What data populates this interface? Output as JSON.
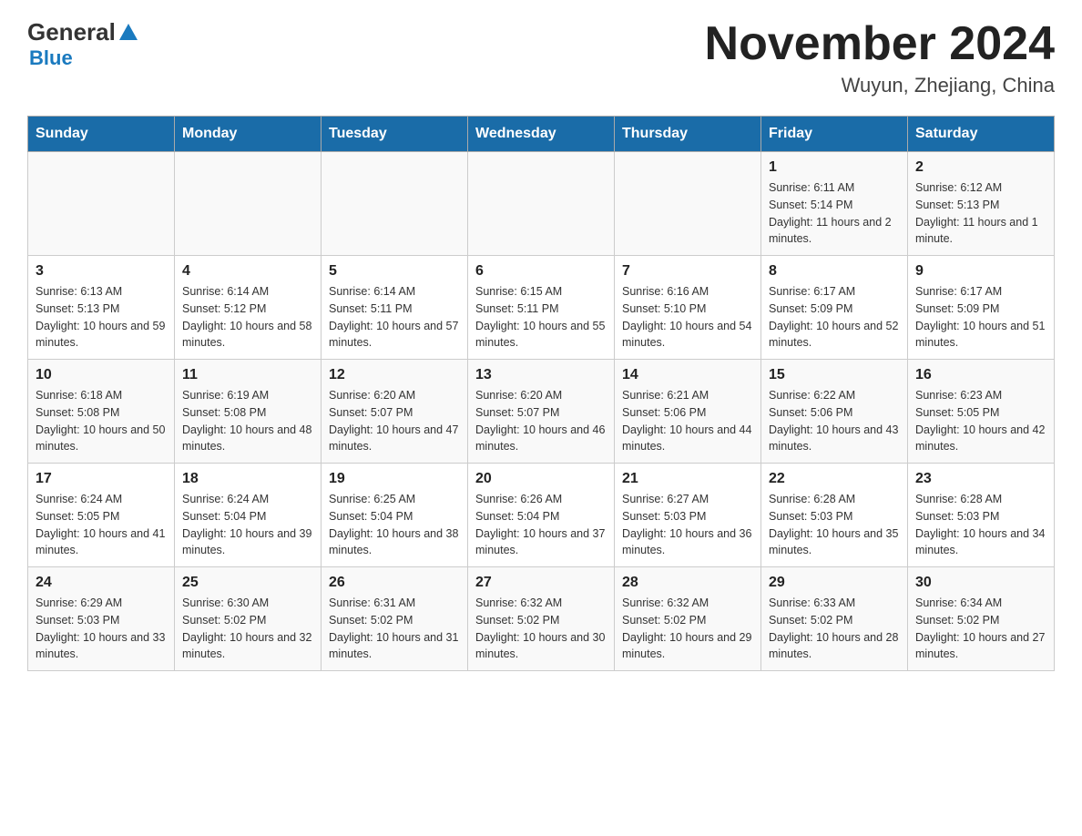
{
  "header": {
    "logo": {
      "general": "General",
      "blue": "Blue",
      "subtitle": "Blue"
    },
    "title": "November 2024",
    "location": "Wuyun, Zhejiang, China"
  },
  "days_of_week": [
    "Sunday",
    "Monday",
    "Tuesday",
    "Wednesday",
    "Thursday",
    "Friday",
    "Saturday"
  ],
  "weeks": [
    {
      "days": [
        {
          "number": "",
          "sunrise": "",
          "sunset": "",
          "daylight": ""
        },
        {
          "number": "",
          "sunrise": "",
          "sunset": "",
          "daylight": ""
        },
        {
          "number": "",
          "sunrise": "",
          "sunset": "",
          "daylight": ""
        },
        {
          "number": "",
          "sunrise": "",
          "sunset": "",
          "daylight": ""
        },
        {
          "number": "",
          "sunrise": "",
          "sunset": "",
          "daylight": ""
        },
        {
          "number": "1",
          "sunrise": "Sunrise: 6:11 AM",
          "sunset": "Sunset: 5:14 PM",
          "daylight": "Daylight: 11 hours and 2 minutes."
        },
        {
          "number": "2",
          "sunrise": "Sunrise: 6:12 AM",
          "sunset": "Sunset: 5:13 PM",
          "daylight": "Daylight: 11 hours and 1 minute."
        }
      ]
    },
    {
      "days": [
        {
          "number": "3",
          "sunrise": "Sunrise: 6:13 AM",
          "sunset": "Sunset: 5:13 PM",
          "daylight": "Daylight: 10 hours and 59 minutes."
        },
        {
          "number": "4",
          "sunrise": "Sunrise: 6:14 AM",
          "sunset": "Sunset: 5:12 PM",
          "daylight": "Daylight: 10 hours and 58 minutes."
        },
        {
          "number": "5",
          "sunrise": "Sunrise: 6:14 AM",
          "sunset": "Sunset: 5:11 PM",
          "daylight": "Daylight: 10 hours and 57 minutes."
        },
        {
          "number": "6",
          "sunrise": "Sunrise: 6:15 AM",
          "sunset": "Sunset: 5:11 PM",
          "daylight": "Daylight: 10 hours and 55 minutes."
        },
        {
          "number": "7",
          "sunrise": "Sunrise: 6:16 AM",
          "sunset": "Sunset: 5:10 PM",
          "daylight": "Daylight: 10 hours and 54 minutes."
        },
        {
          "number": "8",
          "sunrise": "Sunrise: 6:17 AM",
          "sunset": "Sunset: 5:09 PM",
          "daylight": "Daylight: 10 hours and 52 minutes."
        },
        {
          "number": "9",
          "sunrise": "Sunrise: 6:17 AM",
          "sunset": "Sunset: 5:09 PM",
          "daylight": "Daylight: 10 hours and 51 minutes."
        }
      ]
    },
    {
      "days": [
        {
          "number": "10",
          "sunrise": "Sunrise: 6:18 AM",
          "sunset": "Sunset: 5:08 PM",
          "daylight": "Daylight: 10 hours and 50 minutes."
        },
        {
          "number": "11",
          "sunrise": "Sunrise: 6:19 AM",
          "sunset": "Sunset: 5:08 PM",
          "daylight": "Daylight: 10 hours and 48 minutes."
        },
        {
          "number": "12",
          "sunrise": "Sunrise: 6:20 AM",
          "sunset": "Sunset: 5:07 PM",
          "daylight": "Daylight: 10 hours and 47 minutes."
        },
        {
          "number": "13",
          "sunrise": "Sunrise: 6:20 AM",
          "sunset": "Sunset: 5:07 PM",
          "daylight": "Daylight: 10 hours and 46 minutes."
        },
        {
          "number": "14",
          "sunrise": "Sunrise: 6:21 AM",
          "sunset": "Sunset: 5:06 PM",
          "daylight": "Daylight: 10 hours and 44 minutes."
        },
        {
          "number": "15",
          "sunrise": "Sunrise: 6:22 AM",
          "sunset": "Sunset: 5:06 PM",
          "daylight": "Daylight: 10 hours and 43 minutes."
        },
        {
          "number": "16",
          "sunrise": "Sunrise: 6:23 AM",
          "sunset": "Sunset: 5:05 PM",
          "daylight": "Daylight: 10 hours and 42 minutes."
        }
      ]
    },
    {
      "days": [
        {
          "number": "17",
          "sunrise": "Sunrise: 6:24 AM",
          "sunset": "Sunset: 5:05 PM",
          "daylight": "Daylight: 10 hours and 41 minutes."
        },
        {
          "number": "18",
          "sunrise": "Sunrise: 6:24 AM",
          "sunset": "Sunset: 5:04 PM",
          "daylight": "Daylight: 10 hours and 39 minutes."
        },
        {
          "number": "19",
          "sunrise": "Sunrise: 6:25 AM",
          "sunset": "Sunset: 5:04 PM",
          "daylight": "Daylight: 10 hours and 38 minutes."
        },
        {
          "number": "20",
          "sunrise": "Sunrise: 6:26 AM",
          "sunset": "Sunset: 5:04 PM",
          "daylight": "Daylight: 10 hours and 37 minutes."
        },
        {
          "number": "21",
          "sunrise": "Sunrise: 6:27 AM",
          "sunset": "Sunset: 5:03 PM",
          "daylight": "Daylight: 10 hours and 36 minutes."
        },
        {
          "number": "22",
          "sunrise": "Sunrise: 6:28 AM",
          "sunset": "Sunset: 5:03 PM",
          "daylight": "Daylight: 10 hours and 35 minutes."
        },
        {
          "number": "23",
          "sunrise": "Sunrise: 6:28 AM",
          "sunset": "Sunset: 5:03 PM",
          "daylight": "Daylight: 10 hours and 34 minutes."
        }
      ]
    },
    {
      "days": [
        {
          "number": "24",
          "sunrise": "Sunrise: 6:29 AM",
          "sunset": "Sunset: 5:03 PM",
          "daylight": "Daylight: 10 hours and 33 minutes."
        },
        {
          "number": "25",
          "sunrise": "Sunrise: 6:30 AM",
          "sunset": "Sunset: 5:02 PM",
          "daylight": "Daylight: 10 hours and 32 minutes."
        },
        {
          "number": "26",
          "sunrise": "Sunrise: 6:31 AM",
          "sunset": "Sunset: 5:02 PM",
          "daylight": "Daylight: 10 hours and 31 minutes."
        },
        {
          "number": "27",
          "sunrise": "Sunrise: 6:32 AM",
          "sunset": "Sunset: 5:02 PM",
          "daylight": "Daylight: 10 hours and 30 minutes."
        },
        {
          "number": "28",
          "sunrise": "Sunrise: 6:32 AM",
          "sunset": "Sunset: 5:02 PM",
          "daylight": "Daylight: 10 hours and 29 minutes."
        },
        {
          "number": "29",
          "sunrise": "Sunrise: 6:33 AM",
          "sunset": "Sunset: 5:02 PM",
          "daylight": "Daylight: 10 hours and 28 minutes."
        },
        {
          "number": "30",
          "sunrise": "Sunrise: 6:34 AM",
          "sunset": "Sunset: 5:02 PM",
          "daylight": "Daylight: 10 hours and 27 minutes."
        }
      ]
    }
  ]
}
